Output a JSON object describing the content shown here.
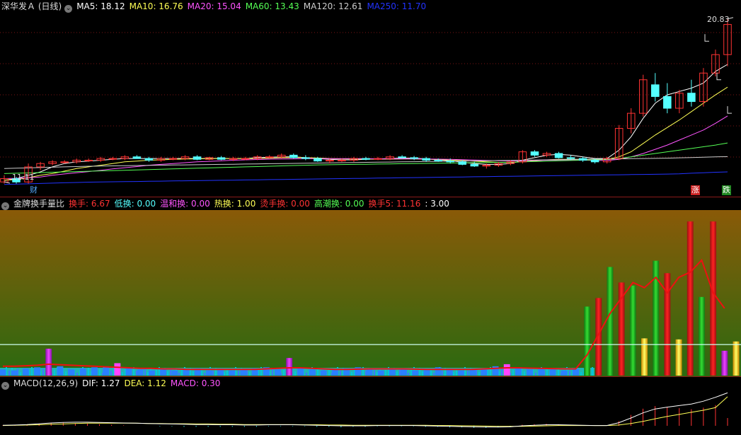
{
  "price_panel": {
    "title": "深华发Ａ (日线)",
    "ma_items": [
      {
        "label": "MA5: 18.12",
        "color": "#ffffff"
      },
      {
        "label": "MA10: 16.76",
        "color": "#ffff55"
      },
      {
        "label": "MA20: 15.04",
        "color": "#ff55ff"
      },
      {
        "label": "MA60: 13.43",
        "color": "#55ff55"
      },
      {
        "label": "MA120: 12.61",
        "color": "#cccccc"
      },
      {
        "label": "MA250: 11.70",
        "color": "#2233ff"
      }
    ],
    "high_label": "20.83",
    "low_label": "11.11",
    "tag_cai": "财",
    "tag_zhang": "涨",
    "tag_die": "跌"
  },
  "turnover_panel": {
    "title": "金牌换手量比",
    "items": [
      {
        "label": "换手: 6.67",
        "color": "#ff3333"
      },
      {
        "label": "低换: 0.00",
        "color": "#55ffff"
      },
      {
        "label": "温和换: 0.00",
        "color": "#ff55ff"
      },
      {
        "label": "热换: 1.00",
        "color": "#ffff55"
      },
      {
        "label": "烫手换: 0.00",
        "color": "#ff3333"
      },
      {
        "label": "高潮换: 0.00",
        "color": "#55ff55"
      },
      {
        "label": "换手5: 11.16",
        "color": "#ff3333"
      },
      {
        "label": ": 3.00",
        "color": "#ffffff"
      }
    ]
  },
  "macd_panel": {
    "items": [
      {
        "label": "MACD(12,26,9)",
        "color": "#dddddd"
      },
      {
        "label": "DIF: 1.27",
        "color": "#ffffff"
      },
      {
        "label": "DEA: 1.12",
        "color": "#ffff55"
      },
      {
        "label": "MACD: 0.30",
        "color": "#ff55ff"
      }
    ]
  },
  "chart_data": {
    "type": "candlestick",
    "price_range": [
      10.9,
      21.2
    ],
    "candles": [
      [
        11.1,
        11.5,
        11.0,
        11.3
      ],
      [
        11.3,
        11.4,
        11.0,
        11.1
      ],
      [
        11.1,
        12.2,
        11.0,
        12.0
      ],
      [
        12.0,
        12.3,
        11.8,
        12.2
      ],
      [
        12.2,
        12.4,
        12.1,
        12.3
      ],
      [
        12.3,
        12.4,
        12.2,
        12.3
      ],
      [
        12.3,
        12.5,
        12.2,
        12.4
      ],
      [
        12.4,
        12.5,
        12.3,
        12.4
      ],
      [
        12.4,
        12.6,
        12.3,
        12.5
      ],
      [
        12.5,
        12.6,
        12.4,
        12.5
      ],
      [
        12.5,
        12.7,
        12.4,
        12.6
      ],
      [
        12.6,
        12.7,
        12.5,
        12.5
      ],
      [
        12.5,
        12.6,
        12.3,
        12.4
      ],
      [
        12.4,
        12.6,
        12.3,
        12.5
      ],
      [
        12.5,
        12.6,
        12.4,
        12.5
      ],
      [
        12.5,
        12.7,
        12.4,
        12.6
      ],
      [
        12.6,
        12.7,
        12.4,
        12.45
      ],
      [
        12.45,
        12.6,
        12.4,
        12.55
      ],
      [
        12.55,
        12.65,
        12.4,
        12.45
      ],
      [
        12.45,
        12.6,
        12.35,
        12.5
      ],
      [
        12.5,
        12.6,
        12.4,
        12.5
      ],
      [
        12.5,
        12.7,
        12.4,
        12.6
      ],
      [
        12.6,
        12.7,
        12.5,
        12.6
      ],
      [
        12.6,
        12.8,
        12.5,
        12.7
      ],
      [
        12.7,
        12.8,
        12.5,
        12.55
      ],
      [
        12.55,
        12.7,
        12.4,
        12.5
      ],
      [
        12.5,
        12.6,
        12.3,
        12.35
      ],
      [
        12.35,
        12.5,
        12.2,
        12.4
      ],
      [
        12.4,
        12.5,
        12.3,
        12.4
      ],
      [
        12.4,
        12.6,
        12.3,
        12.5
      ],
      [
        12.5,
        12.6,
        12.4,
        12.45
      ],
      [
        12.45,
        12.6,
        12.4,
        12.5
      ],
      [
        12.5,
        12.7,
        12.4,
        12.6
      ],
      [
        12.6,
        12.7,
        12.5,
        12.55
      ],
      [
        12.55,
        12.65,
        12.4,
        12.5
      ],
      [
        12.5,
        12.6,
        12.3,
        12.4
      ],
      [
        12.4,
        12.5,
        12.3,
        12.35
      ],
      [
        12.35,
        12.5,
        12.2,
        12.3
      ],
      [
        12.3,
        12.4,
        12.1,
        12.15
      ],
      [
        12.15,
        12.3,
        12.0,
        12.05
      ],
      [
        12.05,
        12.2,
        11.9,
        12.1
      ],
      [
        12.1,
        12.3,
        12.0,
        12.2
      ],
      [
        12.2,
        12.4,
        12.1,
        12.3
      ],
      [
        12.3,
        13.0,
        12.2,
        12.9
      ],
      [
        12.9,
        13.0,
        12.6,
        12.7
      ],
      [
        12.7,
        12.9,
        12.6,
        12.8
      ],
      [
        12.8,
        12.9,
        12.5,
        12.55
      ],
      [
        12.55,
        12.7,
        12.4,
        12.5
      ],
      [
        12.5,
        12.6,
        12.3,
        12.4
      ],
      [
        12.4,
        12.5,
        12.2,
        12.3
      ],
      [
        12.3,
        12.6,
        12.2,
        12.5
      ],
      [
        12.5,
        14.5,
        12.4,
        14.3
      ],
      [
        14.3,
        15.5,
        14.0,
        15.2
      ],
      [
        15.2,
        17.5,
        15.0,
        17.2
      ],
      [
        16.9,
        17.6,
        15.9,
        16.2
      ],
      [
        16.2,
        17.0,
        15.2,
        15.5
      ],
      [
        15.5,
        16.6,
        15.2,
        16.4
      ],
      [
        16.4,
        17.2,
        15.6,
        15.9
      ],
      [
        15.9,
        17.9,
        15.6,
        17.6
      ],
      [
        17.6,
        19.0,
        17.4,
        18.7
      ],
      [
        18.7,
        20.83,
        18.0,
        20.5
      ]
    ],
    "ma_lines": {
      "MA5": [
        11.2,
        11.3,
        11.5,
        11.7,
        12.0,
        12.2,
        12.3,
        12.35,
        12.4,
        12.45,
        12.5,
        12.5,
        12.5,
        12.5,
        12.5,
        12.5,
        12.5,
        12.5,
        12.5,
        12.5,
        12.5,
        12.55,
        12.58,
        12.6,
        12.6,
        12.55,
        12.5,
        12.45,
        12.42,
        12.42,
        12.45,
        12.48,
        12.5,
        12.52,
        12.52,
        12.48,
        12.42,
        12.36,
        12.28,
        12.2,
        12.15,
        12.15,
        12.2,
        12.4,
        12.55,
        12.7,
        12.75,
        12.7,
        12.6,
        12.5,
        12.5,
        13.0,
        13.8,
        14.9,
        15.8,
        16.3,
        16.5,
        16.7,
        17.0,
        17.7,
        18.12
      ],
      "MA10": [
        11.2,
        11.25,
        11.35,
        11.5,
        11.6,
        11.75,
        11.9,
        12.0,
        12.1,
        12.2,
        12.3,
        12.35,
        12.4,
        12.42,
        12.45,
        12.47,
        12.48,
        12.5,
        12.5,
        12.5,
        12.5,
        12.5,
        12.52,
        12.55,
        12.56,
        12.55,
        12.53,
        12.5,
        12.48,
        12.47,
        12.46,
        12.46,
        12.46,
        12.47,
        12.47,
        12.46,
        12.44,
        12.41,
        12.38,
        12.34,
        12.3,
        12.27,
        12.26,
        12.3,
        12.35,
        12.42,
        12.45,
        12.45,
        12.45,
        12.45,
        12.45,
        12.6,
        12.9,
        13.4,
        13.9,
        14.35,
        14.8,
        15.3,
        15.8,
        16.3,
        16.76
      ],
      "MA20": [
        11.3,
        11.32,
        11.35,
        11.4,
        11.5,
        11.58,
        11.65,
        11.72,
        11.8,
        11.88,
        11.95,
        12.02,
        12.1,
        12.15,
        12.2,
        12.25,
        12.3,
        12.33,
        12.36,
        12.4,
        12.42,
        12.44,
        12.46,
        12.47,
        12.48,
        12.49,
        12.49,
        12.49,
        12.49,
        12.49,
        12.49,
        12.48,
        12.48,
        12.48,
        12.48,
        12.47,
        12.46,
        12.45,
        12.43,
        12.41,
        12.39,
        12.37,
        12.36,
        12.37,
        12.38,
        12.4,
        12.41,
        12.41,
        12.4,
        12.39,
        12.38,
        12.45,
        12.6,
        12.8,
        13.05,
        13.3,
        13.6,
        13.9,
        14.2,
        14.6,
        15.04
      ],
      "MA60": [
        11.6,
        11.62,
        11.64,
        11.66,
        11.68,
        11.7,
        11.72,
        11.74,
        11.76,
        11.78,
        11.8,
        11.82,
        11.84,
        11.86,
        11.88,
        11.9,
        11.92,
        11.94,
        11.96,
        11.98,
        12.0,
        12.02,
        12.04,
        12.06,
        12.08,
        12.1,
        12.12,
        12.13,
        12.14,
        12.15,
        12.16,
        12.17,
        12.18,
        12.19,
        12.2,
        12.21,
        12.22,
        12.23,
        12.24,
        12.25,
        12.26,
        12.27,
        12.28,
        12.3,
        12.32,
        12.34,
        12.36,
        12.38,
        12.4,
        12.42,
        12.44,
        12.5,
        12.6,
        12.7,
        12.8,
        12.9,
        13.0,
        13.1,
        13.2,
        13.3,
        13.43
      ],
      "MA120": [
        11.9,
        11.92,
        11.94,
        11.96,
        11.98,
        12.0,
        12.02,
        12.04,
        12.05,
        12.06,
        12.07,
        12.08,
        12.09,
        12.1,
        12.11,
        12.12,
        12.13,
        12.14,
        12.15,
        12.16,
        12.17,
        12.18,
        12.19,
        12.2,
        12.21,
        12.22,
        12.23,
        12.24,
        12.25,
        12.26,
        12.27,
        12.28,
        12.29,
        12.3,
        12.31,
        12.32,
        12.33,
        12.34,
        12.35,
        12.36,
        12.37,
        12.38,
        12.39,
        12.4,
        12.41,
        12.42,
        12.43,
        12.44,
        12.45,
        12.46,
        12.47,
        12.48,
        12.49,
        12.5,
        12.51,
        12.52,
        12.54,
        12.56,
        12.58,
        12.6,
        12.61
      ],
      "MA250": [
        10.95,
        10.97,
        10.99,
        11.01,
        11.03,
        11.05,
        11.07,
        11.09,
        11.1,
        11.11,
        11.12,
        11.13,
        11.14,
        11.15,
        11.16,
        11.17,
        11.18,
        11.19,
        11.2,
        11.21,
        11.22,
        11.23,
        11.24,
        11.25,
        11.26,
        11.27,
        11.28,
        11.29,
        11.3,
        11.31,
        11.32,
        11.33,
        11.34,
        11.35,
        11.36,
        11.37,
        11.38,
        11.39,
        11.4,
        11.41,
        11.42,
        11.43,
        11.44,
        11.45,
        11.46,
        11.47,
        11.48,
        11.49,
        11.5,
        11.51,
        11.52,
        11.53,
        11.54,
        11.55,
        11.56,
        11.57,
        11.59,
        11.62,
        11.65,
        11.68,
        11.7
      ]
    },
    "turnover_range": [
      0,
      16
    ],
    "turnover": [
      0.6,
      0.5,
      0.7,
      0.8,
      2.6,
      0.9,
      0.6,
      0.7,
      0.8,
      0.9,
      1.2,
      0.7,
      0.6,
      0.5,
      0.6,
      0.5,
      0.6,
      0.7,
      0.5,
      0.6,
      0.5,
      0.6,
      0.7,
      0.8,
      0.6,
      1.7,
      0.7,
      0.6,
      0.5,
      0.6,
      0.7,
      0.8,
      0.6,
      0.5,
      0.6,
      0.7,
      0.5,
      0.6,
      0.8,
      0.6,
      0.5,
      0.6,
      0.7,
      0.9,
      1.1,
      0.8,
      0.6,
      0.7,
      0.6,
      0.5,
      0.6,
      6.67,
      7.5,
      10.5,
      9.0,
      8.7,
      3.6,
      11.1,
      9.9,
      3.5,
      14.9,
      7.6,
      14.9,
      2.4,
      3.3
    ],
    "turnover5": [
      0.9,
      0.9,
      0.95,
      1.0,
      1.1,
      1.05,
      1.0,
      0.95,
      0.9,
      0.85,
      0.8,
      0.75,
      0.7,
      0.7,
      0.65,
      0.65,
      0.6,
      0.6,
      0.6,
      0.6,
      0.6,
      0.6,
      0.6,
      0.65,
      0.7,
      0.75,
      0.75,
      0.7,
      0.65,
      0.6,
      0.6,
      0.62,
      0.65,
      0.65,
      0.65,
      0.65,
      0.62,
      0.6,
      0.6,
      0.6,
      0.6,
      0.6,
      0.65,
      0.7,
      0.75,
      0.75,
      0.72,
      0.7,
      0.68,
      0.65,
      0.65,
      2.0,
      4.0,
      6.0,
      7.5,
      9.0,
      8.5,
      9.5,
      8.0,
      9.5,
      10.0,
      11.16,
      8.0,
      6.5
    ],
    "turnover_ref": 3.0,
    "macd_dif": [
      0.02,
      0.03,
      0.05,
      0.08,
      0.11,
      0.13,
      0.14,
      0.14,
      0.13,
      0.12,
      0.11,
      0.1,
      0.09,
      0.08,
      0.07,
      0.06,
      0.05,
      0.05,
      0.04,
      0.04,
      0.03,
      0.03,
      0.04,
      0.04,
      0.04,
      0.03,
      0.02,
      0.01,
      0.0,
      0.0,
      0.0,
      0.01,
      0.01,
      0.01,
      0.01,
      0.0,
      -0.01,
      -0.02,
      -0.03,
      -0.04,
      -0.05,
      -0.05,
      -0.04,
      0.0,
      0.02,
      0.04,
      0.04,
      0.03,
      0.02,
      0.01,
      0.01,
      0.12,
      0.3,
      0.5,
      0.65,
      0.72,
      0.78,
      0.84,
      0.95,
      1.1,
      1.27
    ],
    "macd_dea": [
      0.01,
      0.02,
      0.03,
      0.04,
      0.06,
      0.07,
      0.09,
      0.1,
      0.1,
      0.1,
      0.1,
      0.1,
      0.09,
      0.09,
      0.08,
      0.08,
      0.07,
      0.07,
      0.06,
      0.06,
      0.05,
      0.05,
      0.05,
      0.05,
      0.05,
      0.04,
      0.04,
      0.03,
      0.03,
      0.02,
      0.02,
      0.02,
      0.02,
      0.02,
      0.02,
      0.02,
      0.01,
      0.01,
      0.0,
      0.0,
      -0.01,
      -0.02,
      -0.02,
      -0.02,
      -0.01,
      0.0,
      0.01,
      0.01,
      0.01,
      0.01,
      0.01,
      0.03,
      0.09,
      0.17,
      0.27,
      0.36,
      0.44,
      0.52,
      0.6,
      0.7,
      1.12
    ],
    "macd_range": [
      -0.3,
      1.5
    ]
  }
}
